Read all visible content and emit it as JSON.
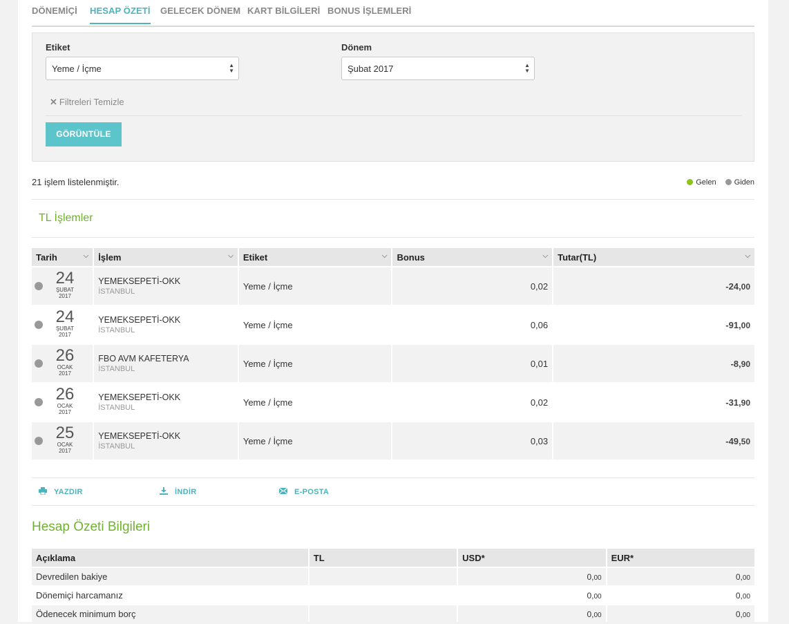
{
  "tabs": [
    {
      "label": "DÖNEMİÇİ"
    },
    {
      "label": "HESAP ÖZETİ"
    },
    {
      "label": "GELECEK DÖNEM"
    },
    {
      "label": "KART BİLGİLERİ"
    },
    {
      "label": "BONUS İŞLEMLERİ"
    }
  ],
  "filters": {
    "tag_label": "Etiket",
    "tag_value": "Yeme / İçme",
    "period_label": "Dönem",
    "period_value": "Şubat 2017",
    "clear_label": "Filtreleri Temizle",
    "view_button": "GÖRÜNTÜLE"
  },
  "summary": {
    "count_text": "21 işlem listelenmiştir.",
    "legend_in": "Gelen",
    "legend_out": "Giden",
    "legend_in_color": "#8dc21f",
    "legend_out_color": "#999999"
  },
  "tl_section_title": "TL İşlemler",
  "table": {
    "headers": [
      "Tarih",
      "İşlem",
      "Etiket",
      "Bonus",
      "Tutar(TL)"
    ],
    "rows": [
      {
        "day": "24",
        "month": "ŞUBAT",
        "year": "2017",
        "merchant": "YEMEKSEPETİ-OKK",
        "city": "İSTANBUL",
        "tag": "Yeme / İçme",
        "bonus": "0,02",
        "amount_main": "-24,",
        "amount_cents": "00"
      },
      {
        "day": "24",
        "month": "ŞUBAT",
        "year": "2017",
        "merchant": "YEMEKSEPETİ-OKK",
        "city": "İSTANBUL",
        "tag": "Yeme / İçme",
        "bonus": "0,06",
        "amount_main": "-91,",
        "amount_cents": "00"
      },
      {
        "day": "26",
        "month": "OCAK",
        "year": "2017",
        "merchant": "FBO AVM KAFETERYA",
        "city": "İSTANBUL",
        "tag": "Yeme / İçme",
        "bonus": "0,01",
        "amount_main": "-8,",
        "amount_cents": "90"
      },
      {
        "day": "26",
        "month": "OCAK",
        "year": "2017",
        "merchant": "YEMEKSEPETİ-OKK",
        "city": "İSTANBUL",
        "tag": "Yeme / İçme",
        "bonus": "0,02",
        "amount_main": "-31,",
        "amount_cents": "90"
      },
      {
        "day": "25",
        "month": "OCAK",
        "year": "2017",
        "merchant": "YEMEKSEPETİ-OKK",
        "city": "İSTANBUL",
        "tag": "Yeme / İçme",
        "bonus": "0,03",
        "amount_main": "-49,",
        "amount_cents": "50"
      }
    ]
  },
  "actions": {
    "print": "YAZDIR",
    "download": "İNDİR",
    "email": "E-POSTA"
  },
  "statement_title": "Hesap Özeti Bilgileri",
  "statement": {
    "headers": [
      "Açıklama",
      "TL",
      "USD*",
      "EUR*"
    ],
    "rows": [
      {
        "label": "Devredilen bakiye",
        "tl": "",
        "usd_main": "0,",
        "usd_cents": "00",
        "eur_main": "0,",
        "eur_cents": "00"
      },
      {
        "label": "Dönemiçi harcamanız",
        "tl": "",
        "usd_main": "0,",
        "usd_cents": "00",
        "eur_main": "0,",
        "eur_cents": "00"
      },
      {
        "label": "Ödenecek minimum borç",
        "tl": "",
        "usd_main": "0,",
        "usd_cents": "00",
        "eur_main": "0,",
        "eur_cents": "00"
      }
    ]
  },
  "colors": {
    "accent": "#4bb3bd",
    "button": "#5cc5cc",
    "section_green": "#6fb22f",
    "out_bullet": "#999999"
  }
}
